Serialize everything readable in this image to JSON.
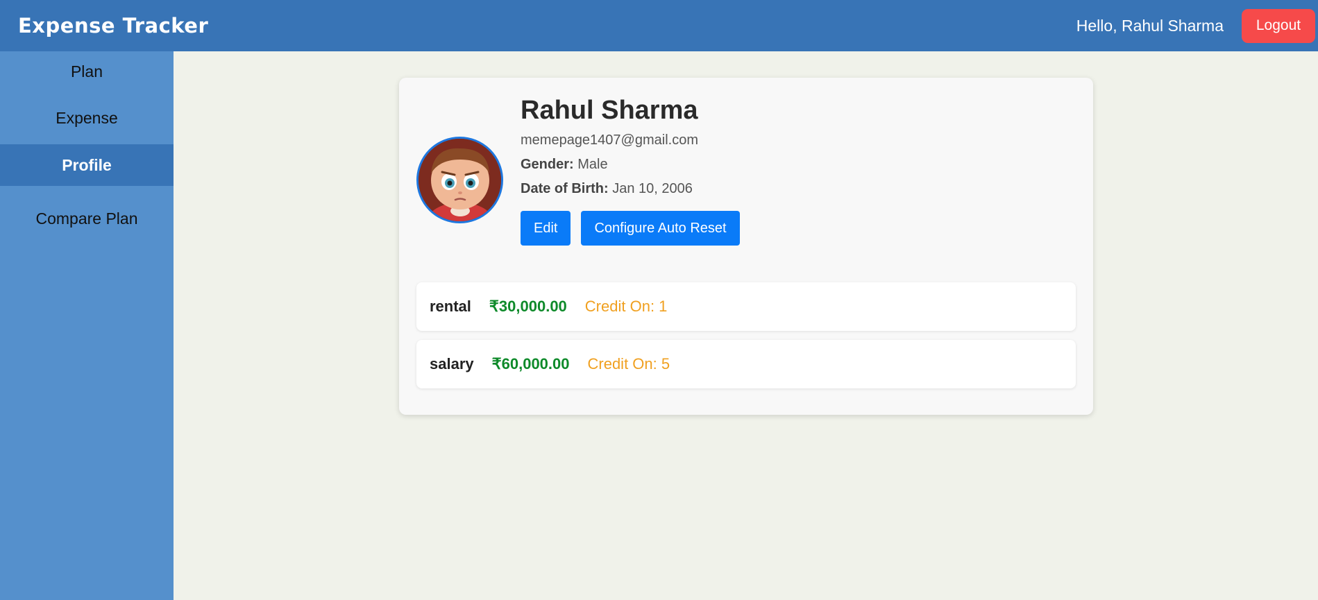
{
  "header": {
    "brand": "Expense Tracker",
    "greeting": "Hello, Rahul Sharma",
    "logout_label": "Logout"
  },
  "sidebar": {
    "items": [
      {
        "label": "Plan"
      },
      {
        "label": "Expense"
      },
      {
        "label": "Profile",
        "active": true
      },
      {
        "label": "Compare Plan"
      }
    ]
  },
  "profile": {
    "name": "Rahul Sharma",
    "email": "memepage1407@gmail.com",
    "gender_label": "Gender:",
    "gender": "Male",
    "dob_label": "Date of Birth:",
    "dob": "Jan 10, 2006",
    "edit_label": "Edit",
    "auto_reset_label": "Configure Auto Reset"
  },
  "credits": [
    {
      "name": "rental",
      "amount": "₹30,000.00",
      "credit": "Credit On: 1"
    },
    {
      "name": "salary",
      "amount": "₹60,000.00",
      "credit": "Credit On: 5"
    }
  ],
  "colors": {
    "header_bg": "#3874b6",
    "sidebar_bg": "#5590cc",
    "logout_bg": "#f64a4a",
    "primary_button": "#0a7bf8",
    "amount": "#0e8a2a",
    "credit_text": "#f0a020"
  }
}
